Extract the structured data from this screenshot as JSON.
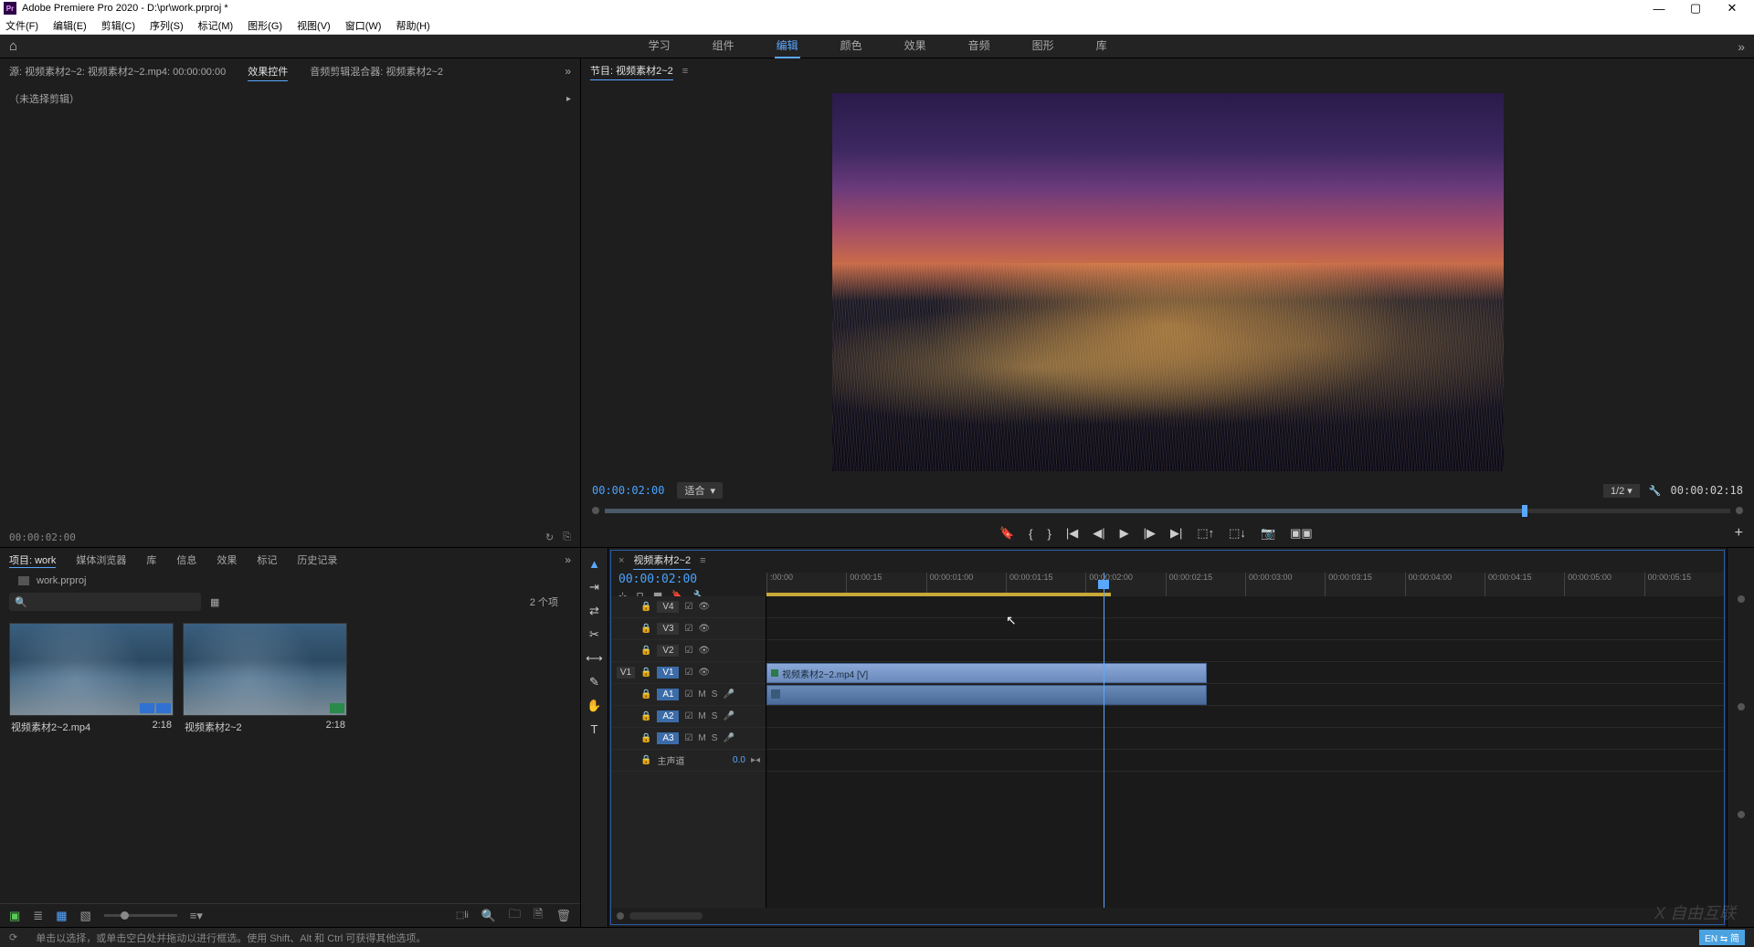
{
  "app": {
    "title": "Adobe Premiere Pro 2020 - D:\\pr\\work.prproj *",
    "iconText": "Pr"
  },
  "menuBar": [
    "文件(F)",
    "编辑(E)",
    "剪辑(C)",
    "序列(S)",
    "标记(M)",
    "图形(G)",
    "视图(V)",
    "窗口(W)",
    "帮助(H)"
  ],
  "workspaceTabs": {
    "items": [
      "学习",
      "组件",
      "编辑",
      "颜色",
      "效果",
      "音频",
      "图形",
      "库"
    ],
    "active": "编辑"
  },
  "sourcePanel": {
    "tabs": {
      "source": "源: 视频素材2~2: 视频素材2~2.mp4: 00:00:00:00",
      "effects": "效果控件",
      "audioMixer": "音频剪辑混合器: 视频素材2~2",
      "active": "效果控件"
    },
    "noSelection": "（未选择剪辑）",
    "timecode": "00:00:02:00"
  },
  "programPanel": {
    "tabTitle": "节目: 视频素材2~2",
    "timecode": "00:00:02:00",
    "fit": "适合",
    "resolution": "1/2",
    "outTimecode": "00:00:02:18"
  },
  "projectPanel": {
    "tabs": [
      "项目: work",
      "媒体浏览器",
      "库",
      "信息",
      "效果",
      "标记",
      "历史记录"
    ],
    "activeTab": "项目: work",
    "projectName": "work.prproj",
    "itemCount": "2 个项",
    "items": [
      {
        "name": "视频素材2~2.mp4",
        "duration": "2:18"
      },
      {
        "name": "视频素材2~2",
        "duration": "2:18"
      }
    ]
  },
  "timeline": {
    "tabTitle": "视频素材2~2",
    "timecode": "00:00:02:00",
    "rulerTicks": [
      ":00:00",
      "00:00:15",
      "00:00:01:00",
      "00:00:01:15",
      "00:00:02:00",
      "00:00:02:15",
      "00:00:03:00",
      "00:00:03:15",
      "00:00:04:00",
      "00:00:04:15",
      "00:00:05:00",
      "00:00:05:15"
    ],
    "tracks": {
      "video": [
        {
          "name": "V4"
        },
        {
          "name": "V3"
        },
        {
          "name": "V2"
        },
        {
          "name": "V1",
          "source": "V1"
        }
      ],
      "audio": [
        {
          "name": "A1"
        },
        {
          "name": "A2"
        },
        {
          "name": "A3"
        }
      ],
      "master": {
        "name": "主声道",
        "value": "0.0"
      }
    },
    "clip": {
      "name": "视频素材2~2.mp4 [V]"
    }
  },
  "statusBar": {
    "hint": "单击以选择，或单击空白处并拖动以进行框选。使用 Shift、Alt 和 Ctrl 可获得其他选项。",
    "ime": "EN ⇆ 简"
  },
  "watermark": "自由互联"
}
